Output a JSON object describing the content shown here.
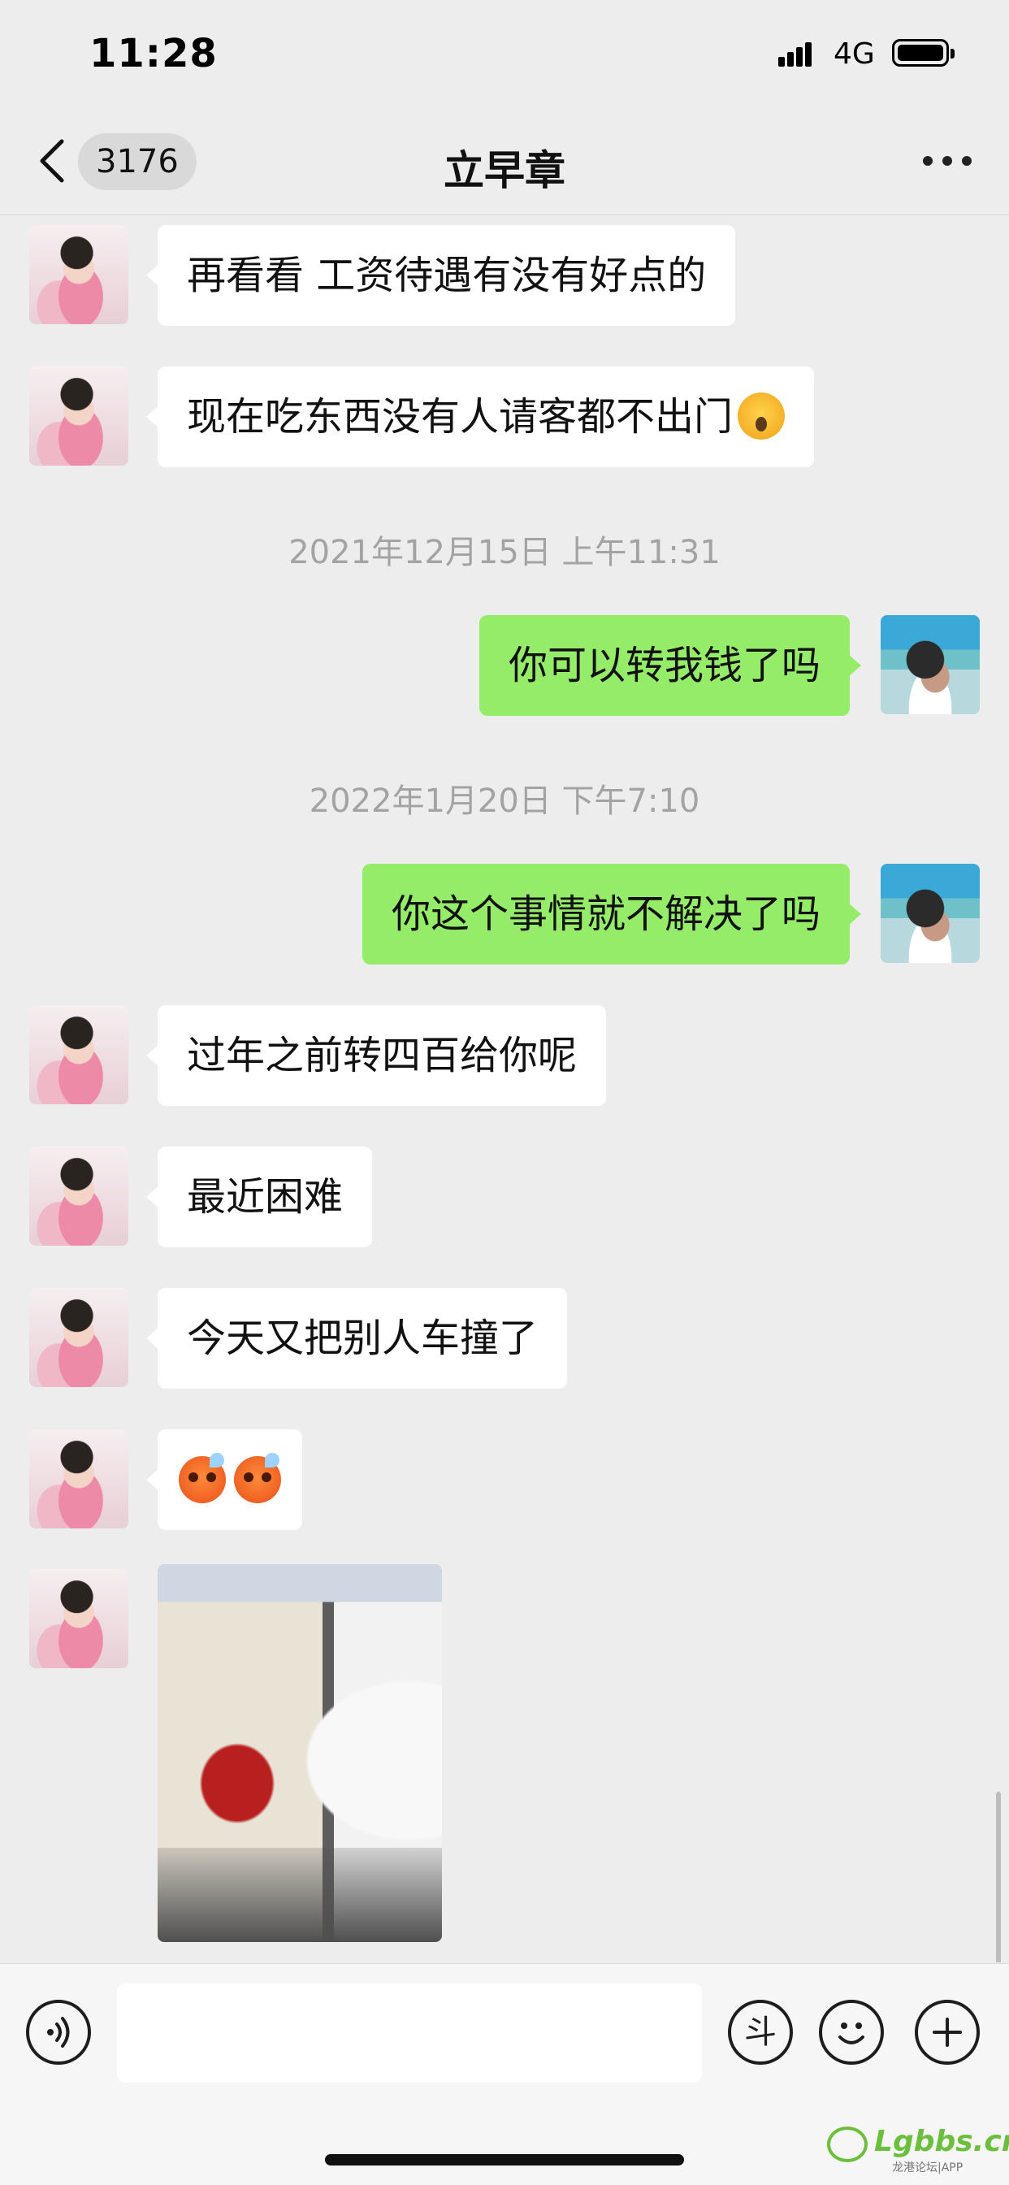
{
  "status_bar": {
    "time": "11:28",
    "network": "4G"
  },
  "nav": {
    "unread_count": "3176",
    "title": "立早章",
    "back_icon": "chevron-left-icon",
    "more_icon": "ellipsis-icon"
  },
  "messages": [
    {
      "side": "in",
      "text": "再看看 工资待遇有没有好点的"
    },
    {
      "side": "in",
      "text": "现在吃东西没有人请客都不出门",
      "emoji": "yawning-face-emoji"
    },
    {
      "type": "timestamp",
      "text": "2021年12月15日 上午11:31"
    },
    {
      "side": "out",
      "text": "你可以转我钱了吗"
    },
    {
      "type": "timestamp",
      "text": "2022年1月20日 下午7:10"
    },
    {
      "side": "out",
      "text": "你这个事情就不解决了吗"
    },
    {
      "side": "in",
      "text": "过年之前转四百给你呢"
    },
    {
      "side": "in",
      "text": "最近困难"
    },
    {
      "side": "in",
      "text": "今天又把别人车撞了"
    },
    {
      "side": "in",
      "emoji": "sad-face-emoji",
      "emoji_count": 2
    },
    {
      "side": "in",
      "type": "image",
      "content": "car-collision-photo"
    }
  ],
  "input_bar": {
    "voice_icon": "voice-icon",
    "text_value": "",
    "dou_label": "斗",
    "emoji_icon": "smiley-icon",
    "plus_icon": "plus-icon"
  },
  "watermark": {
    "brand": "Lgbbs.cn",
    "sub": "龙港论坛|APP"
  },
  "colors": {
    "background": "#ededed",
    "incoming_bubble": "#ffffff",
    "outgoing_bubble": "#95ec69",
    "timestamp_text": "#a3a3a3"
  }
}
